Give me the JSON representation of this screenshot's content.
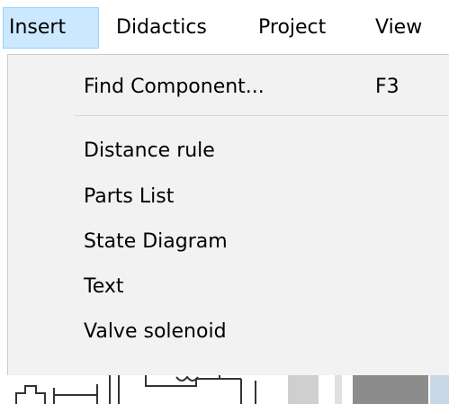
{
  "menubar": {
    "items": [
      {
        "label": "Insert",
        "active": true
      },
      {
        "label": "Didactics"
      },
      {
        "label": "Project"
      },
      {
        "label": "View"
      }
    ]
  },
  "insert_menu": {
    "find_component": {
      "label": "Find Component...",
      "shortcut": "F3"
    },
    "items": [
      {
        "label": "Distance rule"
      },
      {
        "label": "Parts List"
      },
      {
        "label": "State Diagram"
      },
      {
        "label": "Text"
      },
      {
        "label": "Valve solenoid"
      }
    ]
  },
  "colors": {
    "menu_background": "#f2f2f2",
    "active_highlight": "#cce8ff",
    "active_border": "#99d1ff"
  }
}
